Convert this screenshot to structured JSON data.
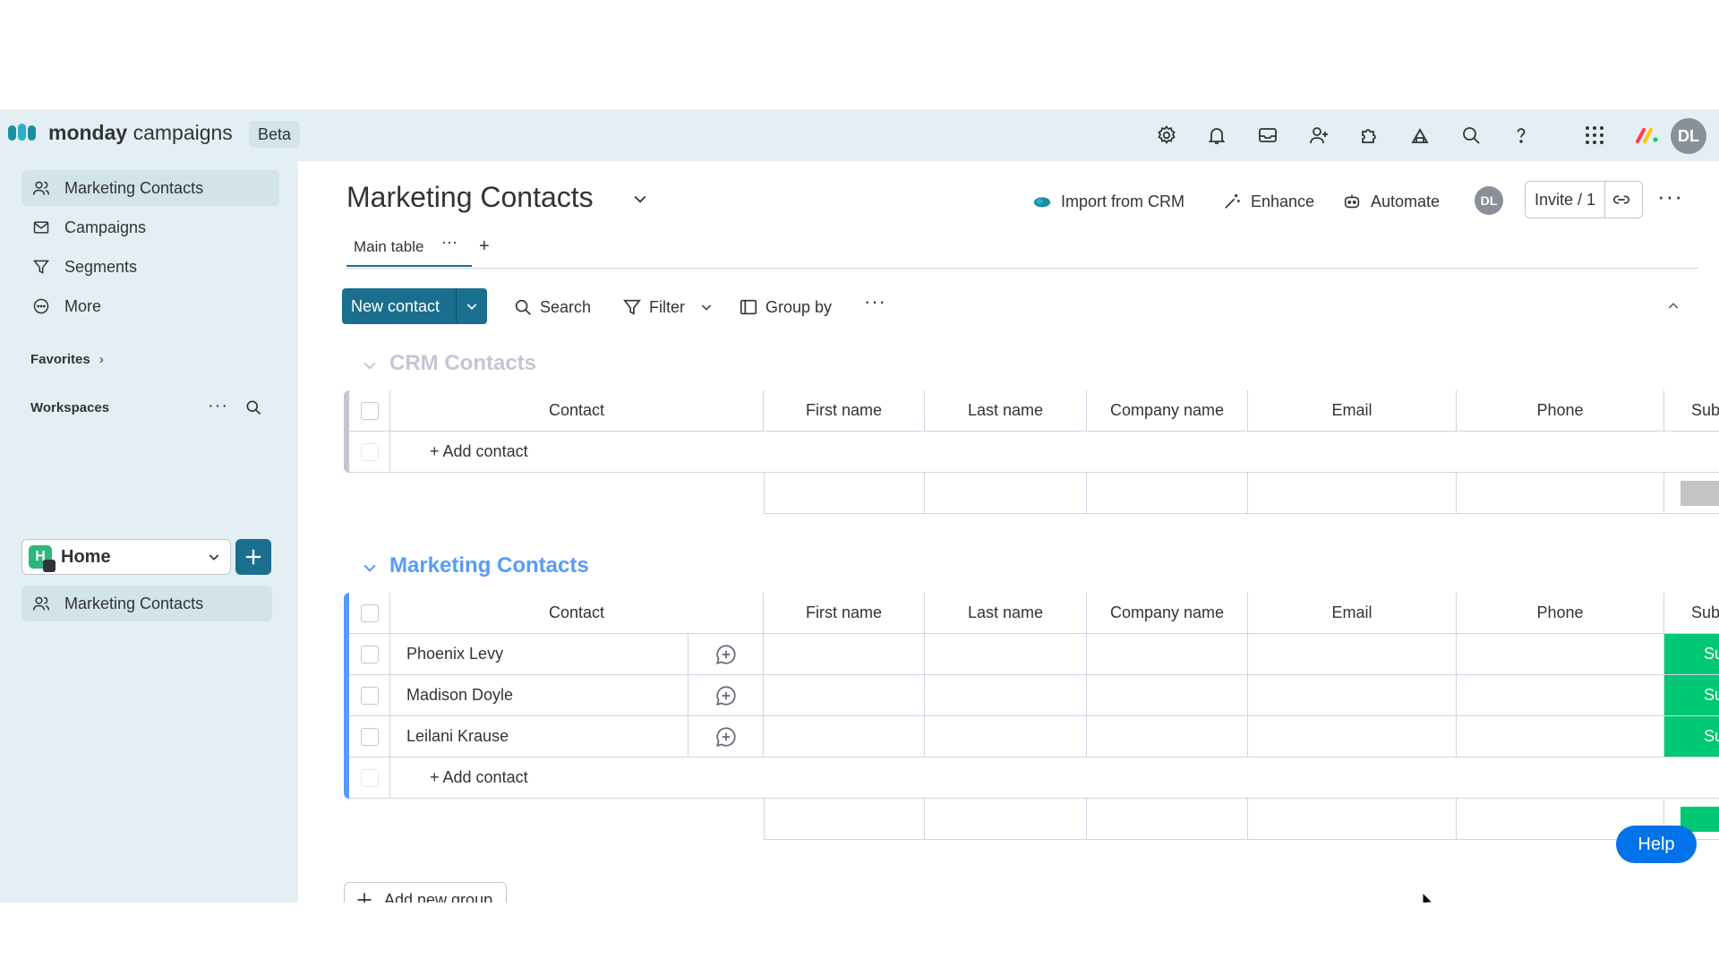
{
  "app": {
    "brand_bold": "monday",
    "brand_light": "campaigns",
    "beta": "Beta",
    "user_initials": "DL"
  },
  "sidebar": {
    "items": [
      {
        "label": "Marketing Contacts",
        "icon": "person-icon",
        "active": true
      },
      {
        "label": "Campaigns",
        "icon": "mail-icon"
      },
      {
        "label": "Segments",
        "icon": "filter-icon"
      },
      {
        "label": "More",
        "icon": "more-circle-icon"
      }
    ],
    "favorites": "Favorites",
    "workspaces": "Workspaces",
    "workspace": {
      "badge": "H",
      "name": "Home"
    },
    "board": "Marketing Contacts"
  },
  "header": {
    "title": "Marketing Contacts",
    "import": "Import from CRM",
    "enhance": "Enhance",
    "automate": "Automate",
    "avatar": "DL",
    "invite": "Invite / 1"
  },
  "tabs": {
    "main": "Main table",
    "add": "+"
  },
  "toolbar": {
    "new_contact": "New contact",
    "search": "Search",
    "filter": "Filter",
    "group_by": "Group by"
  },
  "columns": [
    "Contact",
    "First name",
    "Last name",
    "Company name",
    "Email",
    "Phone",
    "Sub"
  ],
  "groups": [
    {
      "title": "CRM Contacts",
      "color": "#c3c6d4",
      "rows": [],
      "add_row": "+ Add contact"
    },
    {
      "title": "Marketing Contacts",
      "color": "#579bfc",
      "rows": [
        {
          "contact": "Phoenix Levy",
          "status": "Su"
        },
        {
          "contact": "Madison Doyle",
          "status": "Su"
        },
        {
          "contact": "Leilani Krause",
          "status": "Su"
        }
      ],
      "add_row": "+ Add contact"
    }
  ],
  "add_group": "Add new group",
  "help": "Help"
}
